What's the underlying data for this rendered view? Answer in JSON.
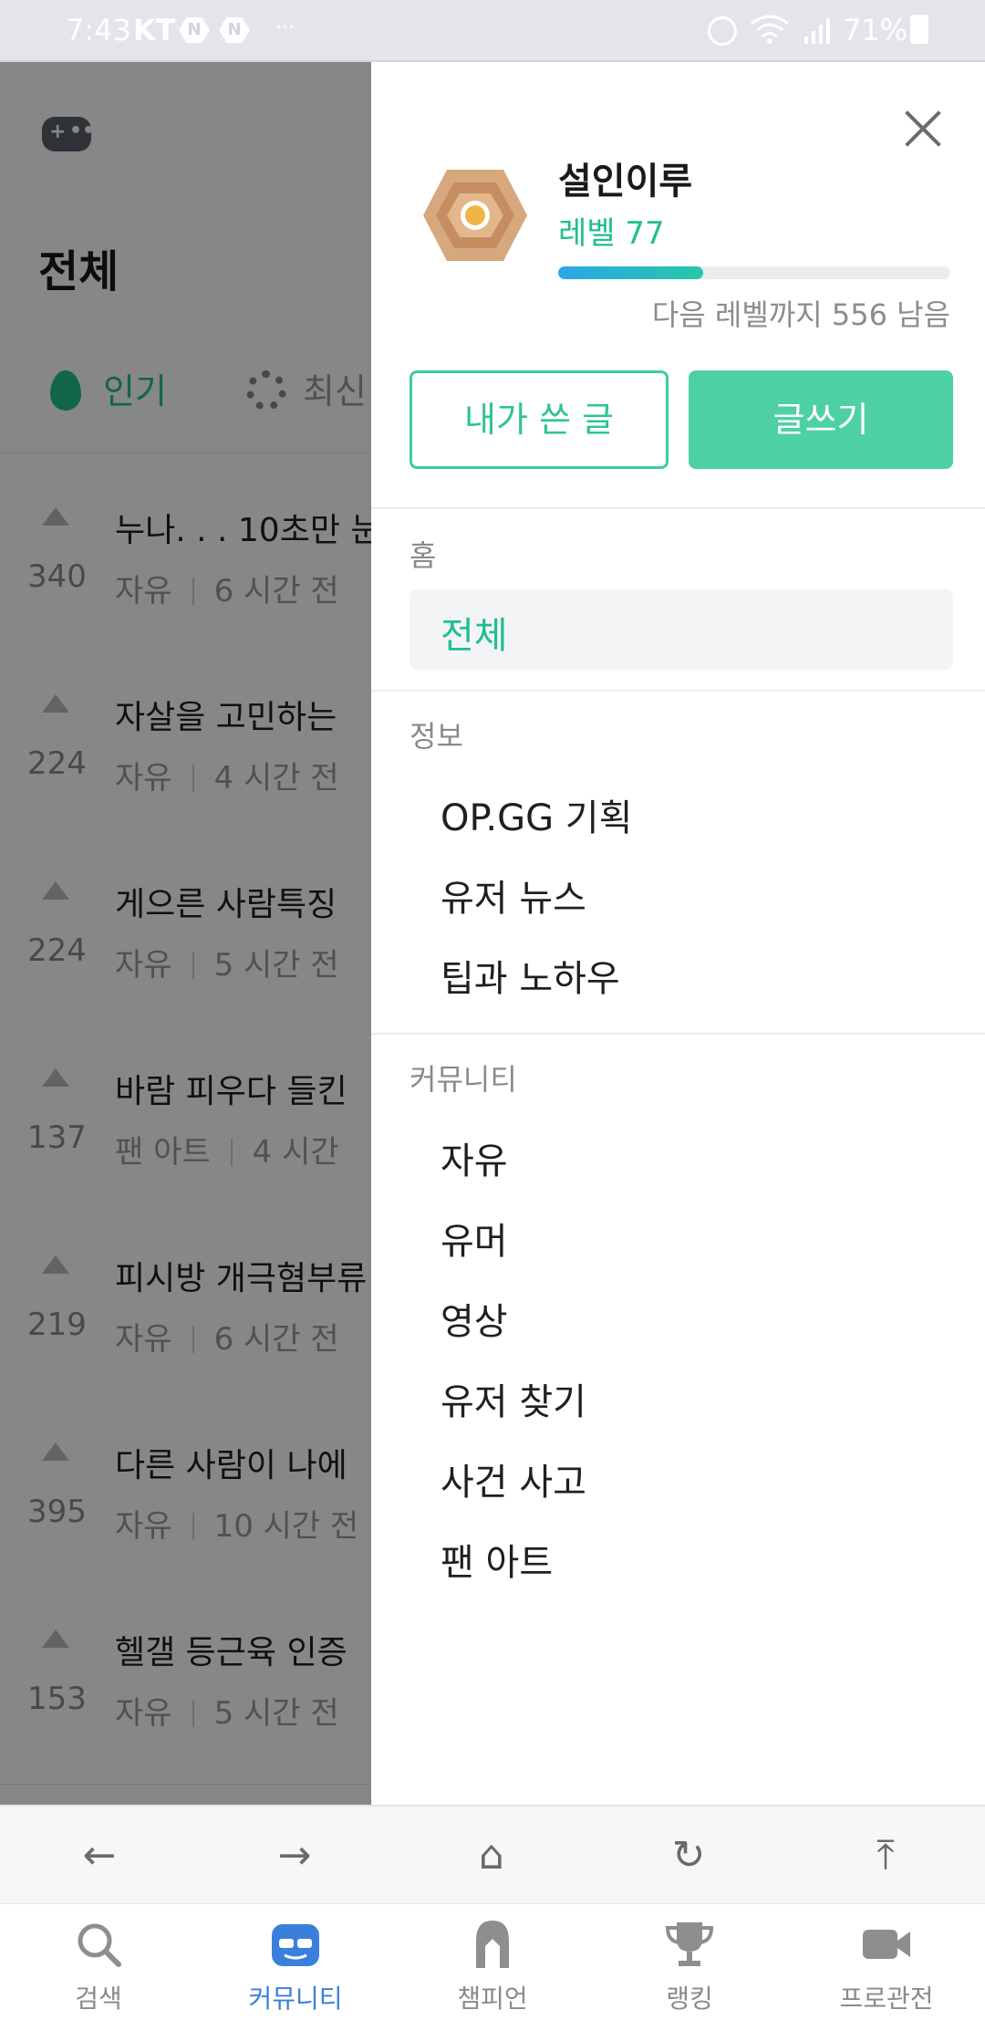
{
  "status_bar": {
    "time": "7:43",
    "carrier": "KT",
    "battery": "71%"
  },
  "background_page": {
    "title": "전체",
    "tabs": [
      {
        "label": "인기"
      },
      {
        "label": "최신"
      }
    ],
    "posts": [
      {
        "votes": "340",
        "title": "누나. . . 10초만 눈",
        "category": "자유",
        "time": "6 시간 전"
      },
      {
        "votes": "224",
        "title": "자살을 고민하는",
        "category": "자유",
        "time": "4 시간 전"
      },
      {
        "votes": "224",
        "title": "게으른 사람특징",
        "category": "자유",
        "time": "5 시간 전"
      },
      {
        "votes": "137",
        "title": "바람 피우다 들킨",
        "category": "팬 아트",
        "time": "4 시간"
      },
      {
        "votes": "219",
        "title": "피시방 개극혐부류",
        "category": "자유",
        "time": "6 시간 전"
      },
      {
        "votes": "395",
        "title": "다른 사람이 나에",
        "category": "자유",
        "time": "10 시간 전"
      },
      {
        "votes": "153",
        "title": "헬갤 등근육 인증",
        "category": "자유",
        "time": "5 시간 전"
      }
    ]
  },
  "drawer": {
    "username": "설인이루",
    "level": "레벨 77",
    "progress_fraction": 0.37,
    "remaining_text": "다음 레벨까지 556 남음",
    "my_posts_label": "내가 쓴 글",
    "write_label": "글쓰기",
    "sections": {
      "home": {
        "label": "홈",
        "items": [
          "전체"
        ]
      },
      "info": {
        "label": "정보",
        "items": [
          "OP.GG 기획",
          "유저 뉴스",
          "팁과 노하우"
        ]
      },
      "community": {
        "label": "커뮤니티",
        "items": [
          "자유",
          "유머",
          "영상",
          "유저 찾기",
          "사건 사고",
          "팬 아트"
        ]
      }
    }
  },
  "browser_nav": {
    "back": "←",
    "forward": "→",
    "home": "⌂",
    "refresh": "↻",
    "top": "⤒"
  },
  "tabbar": {
    "items": [
      {
        "label": "검색",
        "icon": "search-icon"
      },
      {
        "label": "커뮤니티",
        "icon": "community-icon",
        "active": true
      },
      {
        "label": "챔피언",
        "icon": "champion-icon"
      },
      {
        "label": "랭킹",
        "icon": "trophy-icon"
      },
      {
        "label": "프로관전",
        "icon": "video-camera-icon"
      }
    ]
  },
  "colors": {
    "accent": "#1fbf8f",
    "button": "#4ed0a5",
    "active_tab": "#3b7fdc",
    "progress_start": "#2ba6e8",
    "progress_end": "#28c7a8"
  }
}
